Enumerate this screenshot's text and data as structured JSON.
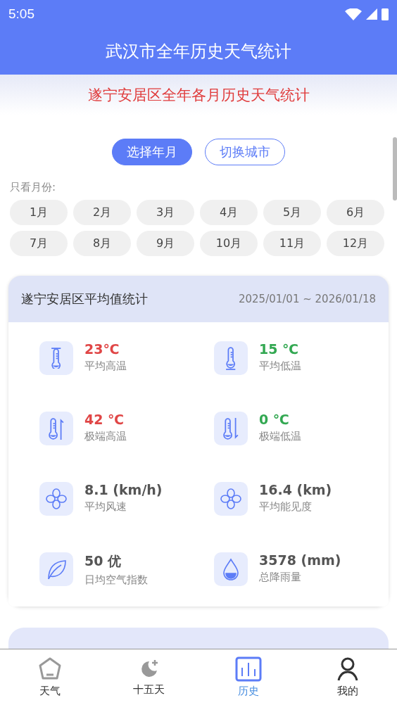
{
  "status_bar": {
    "time": "5:05"
  },
  "header": {
    "title": "武汉市全年历史天气统计"
  },
  "banner": {
    "title": "遂宁安居区全年各月历史天气统计"
  },
  "actions": [
    {
      "label": "选择年月",
      "selected": true
    },
    {
      "label": "切换城市",
      "selected": false
    }
  ],
  "month_filter": {
    "label": "只看月份:",
    "months": [
      "1月",
      "2月",
      "3月",
      "4月",
      "5月",
      "6月",
      "7月",
      "8月",
      "9月",
      "10月",
      "11月",
      "12月"
    ]
  },
  "summary_card": {
    "title": "遂宁安居区平均值统计",
    "range": "2025/01/01 ~ 2026/01/18",
    "stats": [
      {
        "kind": "temp-high",
        "value": "23℃",
        "label": "平均高温",
        "color": "#e04646"
      },
      {
        "kind": "temp-low",
        "value": "15 ℃",
        "label": "平均低温",
        "color": "#33a852"
      },
      {
        "kind": "temp-max",
        "value": "42 ℃",
        "label": "极端高温",
        "color": "#e04646"
      },
      {
        "kind": "temp-min",
        "value": "0 ℃",
        "label": "极端低温",
        "color": "#33a852"
      },
      {
        "kind": "wind",
        "value": "8.1 (km/h)",
        "label": "平均风速",
        "color": "#555555"
      },
      {
        "kind": "wind",
        "value": "16.4 (km)",
        "label": "平均能见度",
        "color": "#555555"
      },
      {
        "kind": "leaf",
        "value": "50 优",
        "label": "日均空气指数",
        "color": "#555555"
      },
      {
        "kind": "drop",
        "value": "3578 (mm)",
        "label": "总降雨量",
        "color": "#555555"
      }
    ]
  },
  "bottom_nav": [
    {
      "kind": "home",
      "label": "天气",
      "selected": false
    },
    {
      "kind": "moon",
      "label": "十五天",
      "selected": false
    },
    {
      "kind": "chart",
      "label": "历史",
      "selected": true
    },
    {
      "kind": "user",
      "label": "我的",
      "selected": false
    }
  ]
}
